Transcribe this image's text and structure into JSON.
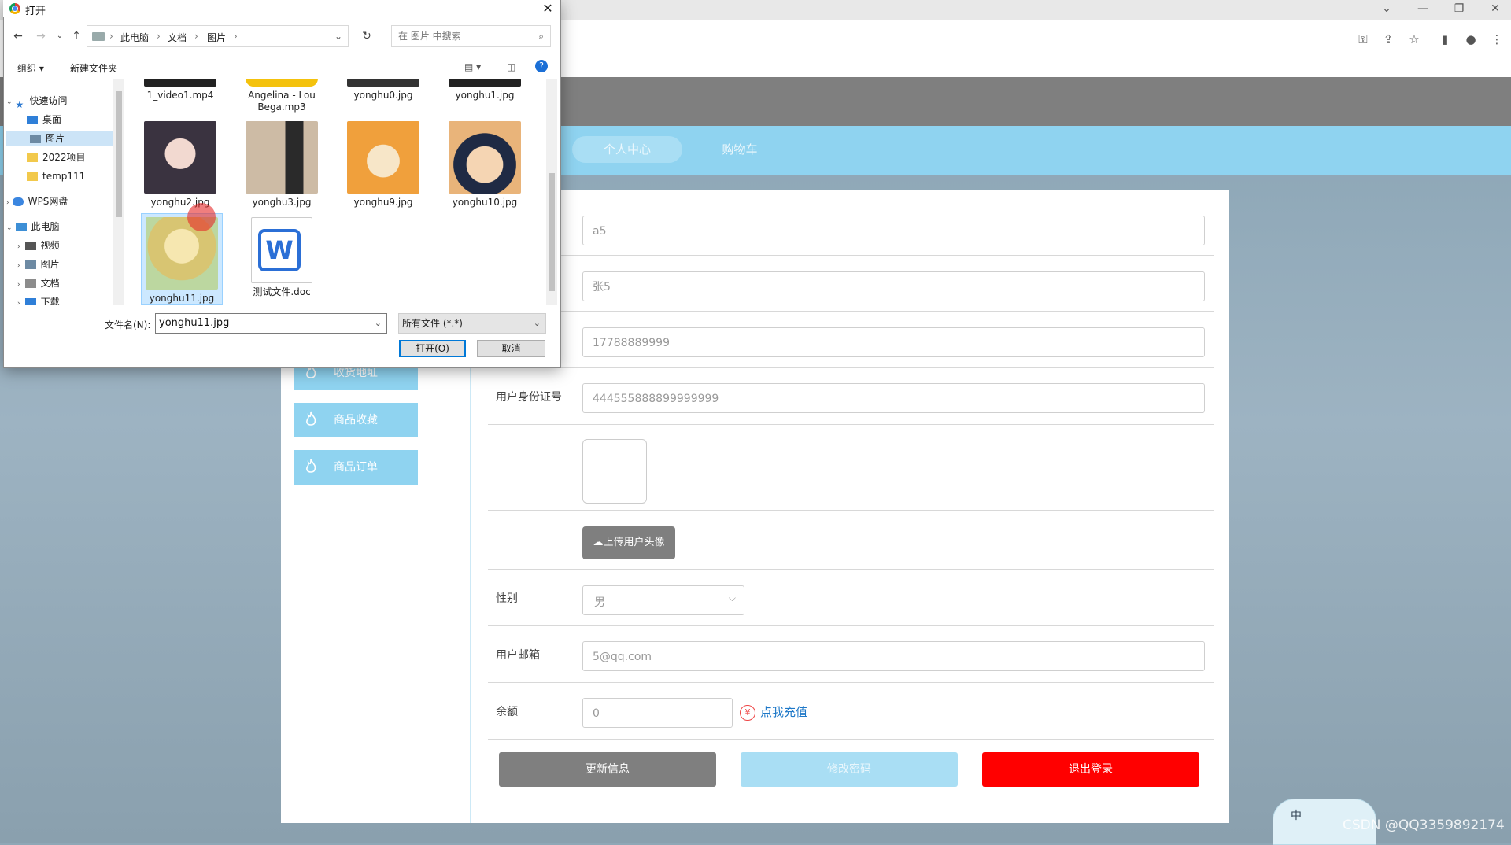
{
  "browser": {
    "window_controls": [
      "⌄",
      "—",
      "❐",
      "✕"
    ],
    "toolbar_icons": [
      "key-icon",
      "share-icon",
      "star-icon",
      "sidebar-icon",
      "profile-icon",
      "menu-icon"
    ]
  },
  "site": {
    "nav": {
      "personal": "个人中心",
      "cart": "购物车"
    },
    "sidebar": [
      {
        "label": "收货地址",
        "icon": "flame-icon"
      },
      {
        "label": "商品收藏",
        "icon": "flame-icon"
      },
      {
        "label": "商品订单",
        "icon": "flame-icon"
      }
    ],
    "form": {
      "username_value": "a5",
      "name_value": "张5",
      "phone_value": "17788889999",
      "id_label": "用户身份证号",
      "id_value": "444555888899999999",
      "upload_label": "上传用户头像",
      "gender_label": "性别",
      "gender_value": "男",
      "email_label": "用户邮箱",
      "email_value": "5@qq.com",
      "balance_label": "余额",
      "balance_value": "0",
      "recharge_symbol": "¥",
      "recharge_label": "点我充值"
    },
    "actions": {
      "update": "更新信息",
      "password": "修改密码",
      "logout": "退出登录"
    }
  },
  "ime": {
    "label": "中"
  },
  "watermark": "CSDN @QQ3359892174",
  "dialog": {
    "title": "打开",
    "close": "✕",
    "breadcrumbs": [
      "此电脑",
      "文档",
      "图片"
    ],
    "search_placeholder": "在 图片 中搜索",
    "cmd": {
      "organize": "组织 ▾",
      "new_folder": "新建文件夹"
    },
    "tree": [
      {
        "label": "快速访问"
      },
      {
        "label": "桌面"
      },
      {
        "label": "图片"
      },
      {
        "label": "2022项目"
      },
      {
        "label": "temp111"
      },
      {
        "label": "WPS网盘"
      },
      {
        "label": "此电脑"
      },
      {
        "label": "视频"
      },
      {
        "label": "图片"
      },
      {
        "label": "文档"
      },
      {
        "label": "下载"
      }
    ],
    "files_top_row": [
      "1_video1.mp4",
      "Angelina - Lou Bega.mp3",
      "yonghu0.jpg",
      "yonghu1.jpg"
    ],
    "files": [
      {
        "name": "yonghu2.jpg",
        "color": "#3a3340"
      },
      {
        "name": "yonghu3.jpg",
        "color": "#b9a48c"
      },
      {
        "name": "yonghu9.jpg",
        "color": "#f0a03c"
      },
      {
        "name": "yonghu10.jpg",
        "color": "#e9b47a"
      },
      {
        "name": "yonghu11.jpg",
        "color": "#e8d78e"
      },
      {
        "name": "测试文件.doc",
        "color": "#2b6fd6"
      }
    ],
    "filename_label": "文件名(N):",
    "filename_value": "yonghu11.jpg",
    "filter_value": "所有文件 (*.*)",
    "open_button": "打开(O)",
    "cancel_button": "取消"
  }
}
